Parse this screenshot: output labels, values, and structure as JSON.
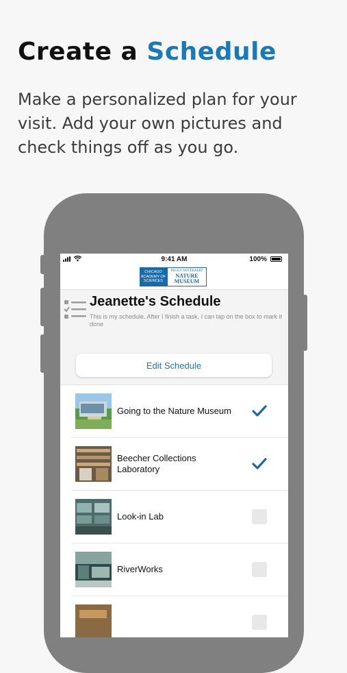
{
  "headline": {
    "prefix": "Create a",
    "accent": "Schedule"
  },
  "subtitle": "Make a personalized plan for your visit. Add your own pictures and check things off as you go.",
  "colors": {
    "accent": "#1b79b8",
    "phone_frame": "#808080",
    "checkmark": "#1b6aa5"
  },
  "status_bar": {
    "time": "9:41 AM",
    "battery": "100%"
  },
  "logos": {
    "cas": [
      "CHICAGO",
      "ACADEMY OF",
      "SCIENCES"
    ],
    "pnnm": [
      "PEGGY NOTEBAERT",
      "NATURE",
      "MUSEUM"
    ]
  },
  "schedule": {
    "title": "Jeanette's Schedule",
    "description": "This is my schedule. After I finish a task, I can tap on the box to mark it done",
    "edit_label": "Edit Schedule"
  },
  "items": [
    {
      "label": "Going to the Nature Museum",
      "checked": true,
      "icon": "building-photo"
    },
    {
      "label": "Beecher Collections Laboratory",
      "checked": true,
      "icon": "lab-shelves-photo"
    },
    {
      "label": "Look-in Lab",
      "checked": false,
      "icon": "lab-photo"
    },
    {
      "label": "RiverWorks",
      "checked": false,
      "icon": "exhibit-photo"
    },
    {
      "label": "",
      "checked": false,
      "icon": "room-photo"
    }
  ]
}
